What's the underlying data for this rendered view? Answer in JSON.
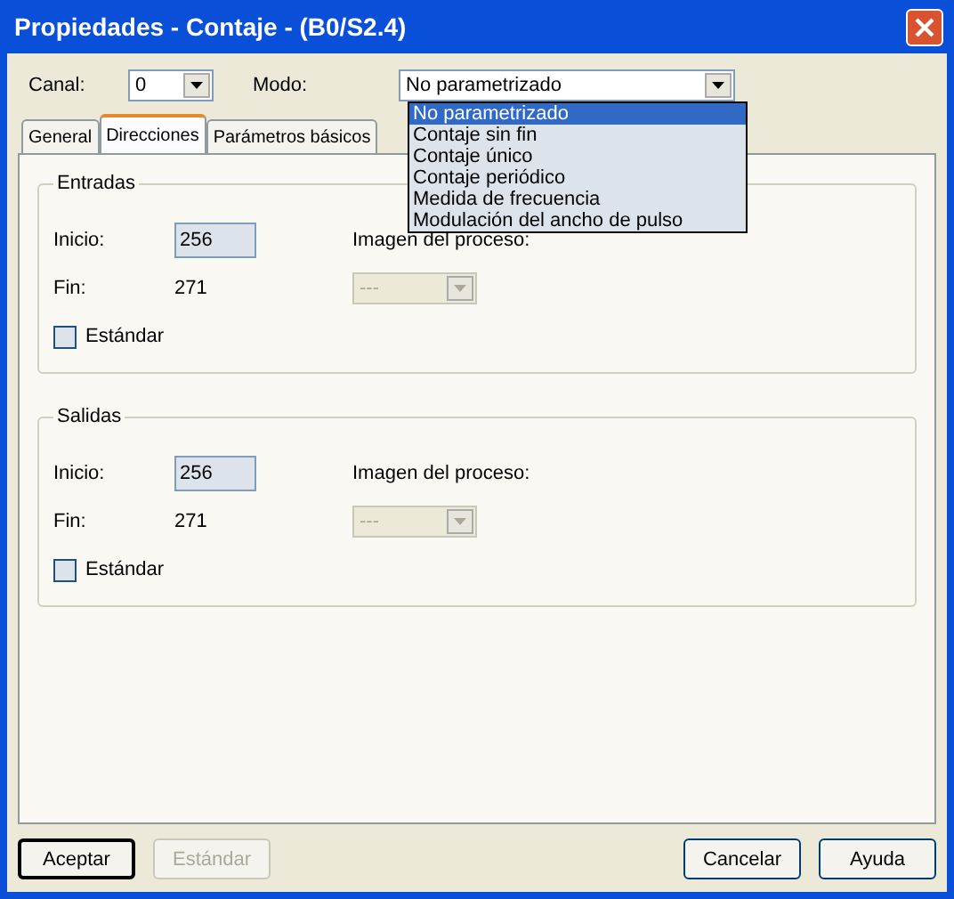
{
  "window": {
    "title": "Propiedades - Contaje - (B0/S2.4)"
  },
  "canal": {
    "label": "Canal:",
    "value": "0"
  },
  "modo": {
    "label": "Modo:",
    "value": "No parametrizado",
    "expanded": true,
    "options": [
      {
        "label": "No parametrizado",
        "selected": true
      },
      {
        "label": "Contaje sin fin",
        "selected": false
      },
      {
        "label": "Contaje único",
        "selected": false
      },
      {
        "label": "Contaje periódico",
        "selected": false
      },
      {
        "label": "Medida de frecuencia",
        "selected": false
      },
      {
        "label": "Modulación del ancho de pulso",
        "selected": false
      }
    ]
  },
  "tabs": [
    {
      "label": "General",
      "selected": false
    },
    {
      "label": "Direcciones",
      "selected": true
    },
    {
      "label": "Parámetros básicos",
      "selected": false
    }
  ],
  "groups": [
    {
      "title": "Entradas",
      "inicio_label": "Inicio:",
      "inicio": "256",
      "fin_label": "Fin:",
      "fin": "271",
      "imagen_label": "Imagen del proceso:",
      "imagen_value": "---",
      "imagen_disabled": true,
      "standard_label": "Estándar",
      "standard_checked": false
    },
    {
      "title": "Salidas",
      "inicio_label": "Inicio:",
      "inicio": "256",
      "fin_label": "Fin:",
      "fin": "271",
      "imagen_label": "Imagen del proceso:",
      "imagen_value": "---",
      "imagen_disabled": true,
      "standard_label": "Estándar",
      "standard_checked": false
    }
  ],
  "buttons": [
    {
      "label": "Aceptar",
      "disabled": false,
      "default": true
    },
    {
      "label": "Estándar",
      "disabled": true,
      "default": false
    },
    {
      "label": "Cancelar",
      "disabled": false,
      "default": false
    },
    {
      "label": "Ayuda",
      "disabled": false,
      "default": false
    }
  ]
}
